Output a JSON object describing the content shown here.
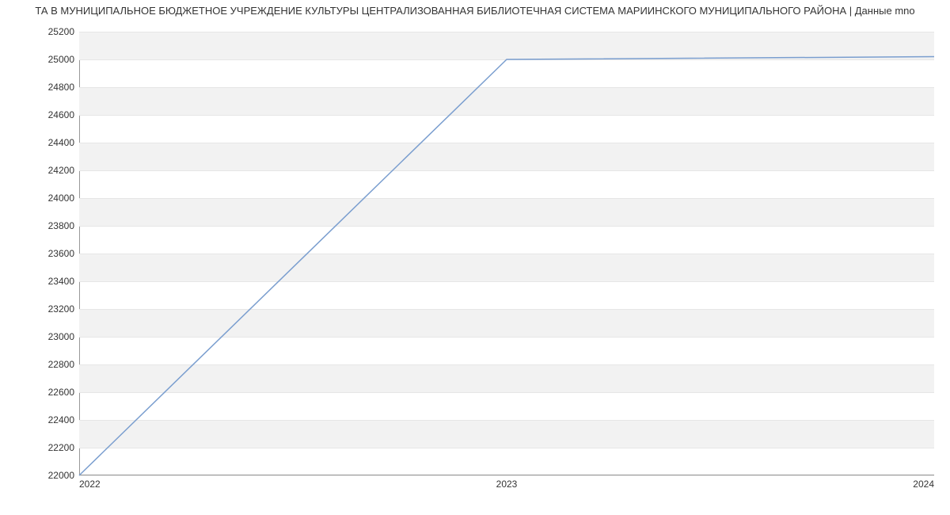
{
  "chart_data": {
    "type": "line",
    "title": "ТА В МУНИЦИПАЛЬНОЕ БЮДЖЕТНОЕ УЧРЕЖДЕНИЕ КУЛЬТУРЫ ЦЕНТРАЛИЗОВАННАЯ БИБЛИОТЕЧНАЯ СИСТЕМА МАРИИНСКОГО МУНИЦИПАЛЬНОГО РАЙОНА | Данные mno",
    "x": [
      2022,
      2023,
      2024
    ],
    "series": [
      {
        "name": "",
        "values": [
          22000,
          25000,
          25020
        ]
      }
    ],
    "x_ticks": [
      2022,
      2023,
      2024
    ],
    "y_ticks": [
      22000,
      22200,
      22400,
      22600,
      22800,
      23000,
      23200,
      23400,
      23600,
      23800,
      24000,
      24200,
      24400,
      24600,
      24800,
      25000,
      25200
    ],
    "xlim": [
      2022,
      2024
    ],
    "ylim": [
      22000,
      25200
    ],
    "xlabel": "",
    "ylabel": "",
    "grid": true,
    "line_color": "#7a9ecf"
  }
}
